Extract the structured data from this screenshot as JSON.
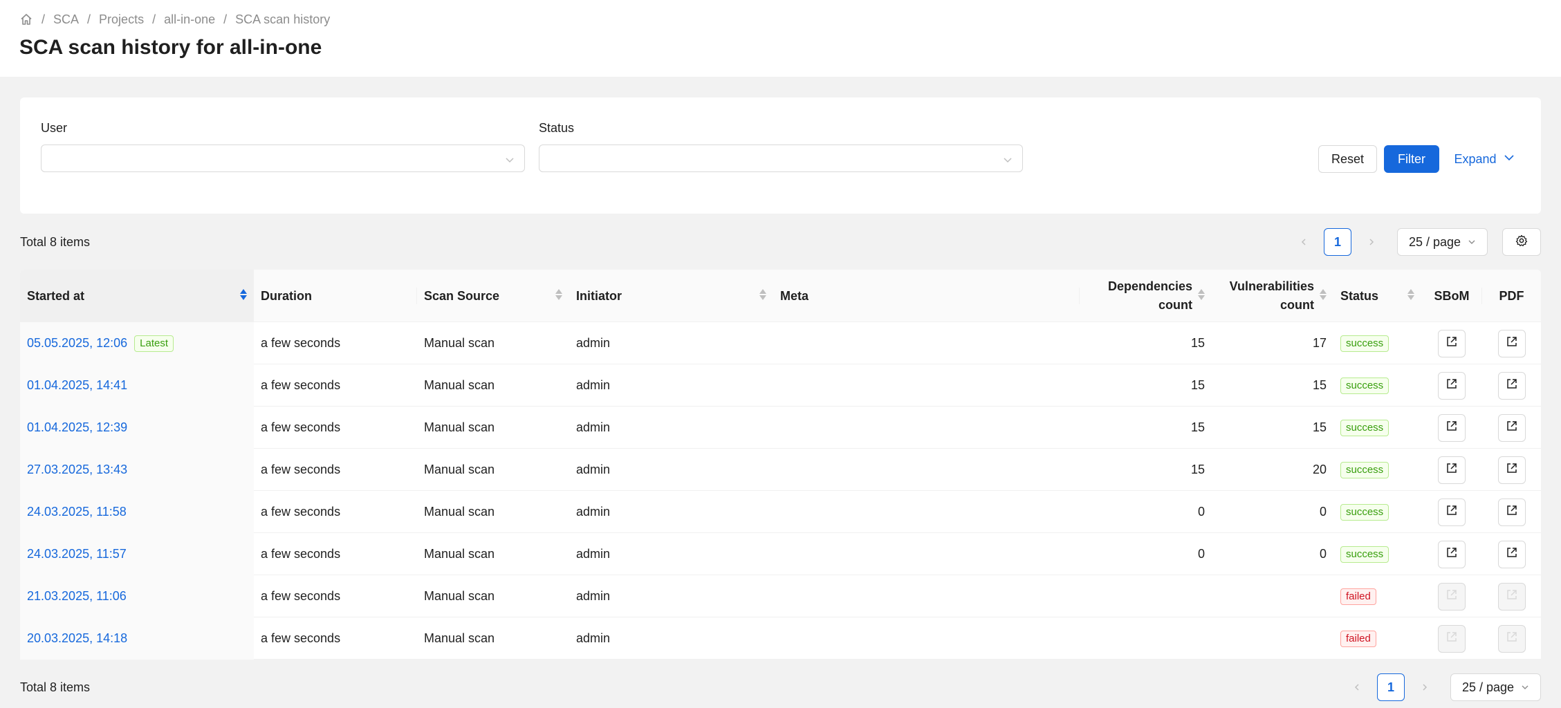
{
  "breadcrumb": {
    "items": [
      "SCA",
      "Projects",
      "all-in-one",
      "SCA scan history"
    ],
    "separator": "/"
  },
  "page_title": "SCA scan history for all-in-one",
  "filters": {
    "user_label": "User",
    "user_value": "",
    "status_label": "Status",
    "status_value": "",
    "reset_label": "Reset",
    "filter_label": "Filter",
    "expand_label": "Expand"
  },
  "summary_top": {
    "total": "Total 8 items",
    "current_page": "1",
    "page_size": "25 / page"
  },
  "summary_bottom": {
    "total": "Total 8 items",
    "current_page": "1",
    "page_size": "25 / page"
  },
  "table": {
    "columns": {
      "started_at": "Started at",
      "duration": "Duration",
      "scan_source": "Scan Source",
      "initiator": "Initiator",
      "meta": "Meta",
      "dependencies_line1": "Dependencies",
      "dependencies_line2": "count",
      "vulnerabilities_line1": "Vulnerabilities",
      "vulnerabilities_line2": "count",
      "status": "Status",
      "sbom": "SBoM",
      "pdf": "PDF"
    },
    "latest_tag": "Latest",
    "rows": [
      {
        "started_at": "05.05.2025, 12:06",
        "latest": true,
        "duration": "a few seconds",
        "source": "Manual scan",
        "initiator": "admin",
        "meta": "",
        "deps": "15",
        "vulns": "17",
        "status": "success"
      },
      {
        "started_at": "01.04.2025, 14:41",
        "latest": false,
        "duration": "a few seconds",
        "source": "Manual scan",
        "initiator": "admin",
        "meta": "",
        "deps": "15",
        "vulns": "15",
        "status": "success"
      },
      {
        "started_at": "01.04.2025, 12:39",
        "latest": false,
        "duration": "a few seconds",
        "source": "Manual scan",
        "initiator": "admin",
        "meta": "",
        "deps": "15",
        "vulns": "15",
        "status": "success"
      },
      {
        "started_at": "27.03.2025, 13:43",
        "latest": false,
        "duration": "a few seconds",
        "source": "Manual scan",
        "initiator": "admin",
        "meta": "",
        "deps": "15",
        "vulns": "20",
        "status": "success"
      },
      {
        "started_at": "24.03.2025, 11:58",
        "latest": false,
        "duration": "a few seconds",
        "source": "Manual scan",
        "initiator": "admin",
        "meta": "",
        "deps": "0",
        "vulns": "0",
        "status": "success"
      },
      {
        "started_at": "24.03.2025, 11:57",
        "latest": false,
        "duration": "a few seconds",
        "source": "Manual scan",
        "initiator": "admin",
        "meta": "",
        "deps": "0",
        "vulns": "0",
        "status": "success"
      },
      {
        "started_at": "21.03.2025, 11:06",
        "latest": false,
        "duration": "a few seconds",
        "source": "Manual scan",
        "initiator": "admin",
        "meta": "",
        "deps": "",
        "vulns": "",
        "status": "failed"
      },
      {
        "started_at": "20.03.2025, 14:18",
        "latest": false,
        "duration": "a few seconds",
        "source": "Manual scan",
        "initiator": "admin",
        "meta": "",
        "deps": "",
        "vulns": "",
        "status": "failed"
      }
    ]
  },
  "icons": {
    "home": "home-icon",
    "chevron": "chevron-down-icon",
    "settings": "gear-icon",
    "export": "external-link-icon"
  },
  "colors": {
    "primary": "#1668dc",
    "success": "#389e0d",
    "failed": "#cf1322"
  }
}
